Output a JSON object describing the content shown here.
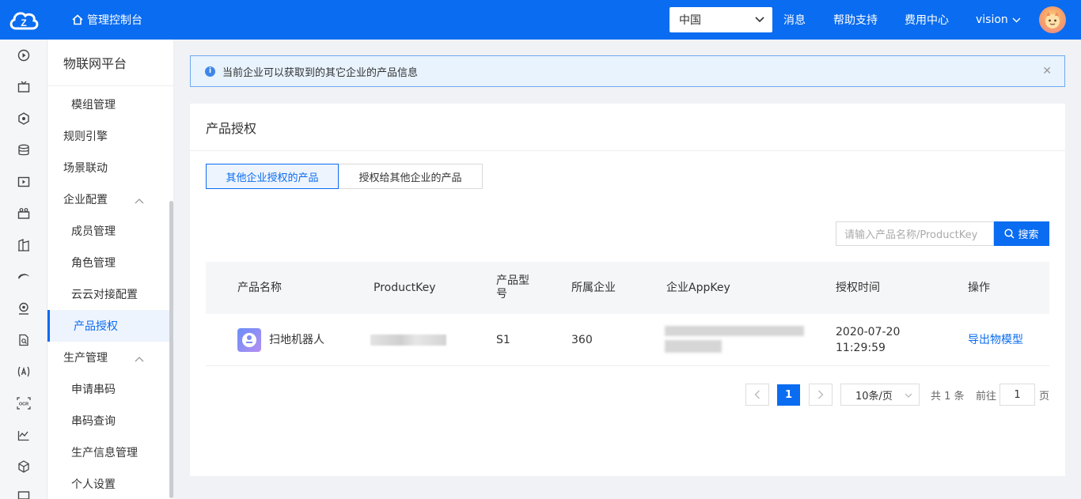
{
  "header": {
    "console_label": "管理控制台",
    "region": "中国",
    "links": [
      "消息",
      "帮助支持",
      "费用中心"
    ],
    "user": "vision"
  },
  "subnav": {
    "title": "物联网平台",
    "items": [
      {
        "label": "模组管理"
      },
      {
        "label": "规则引擎"
      },
      {
        "label": "场景联动"
      },
      {
        "label": "企业配置"
      },
      {
        "label": "成员管理"
      },
      {
        "label": "角色管理"
      },
      {
        "label": "云云对接配置"
      },
      {
        "label": "产品授权"
      },
      {
        "label": "生产管理"
      },
      {
        "label": "申请串码"
      },
      {
        "label": "串码查询"
      },
      {
        "label": "生产信息管理"
      },
      {
        "label": "个人设置"
      }
    ]
  },
  "alert": {
    "text": "当前企业可以获取到的其它企业的产品信息"
  },
  "card": {
    "title": "产品授权",
    "tabs": [
      "其他企业授权的产品",
      "授权给其他企业的产品"
    ],
    "search": {
      "placeholder": "请输入产品名称/ProductKey",
      "button": "搜索"
    },
    "columns": [
      "产品名称",
      "ProductKey",
      "产品型号",
      "所属企业",
      "企业AppKey",
      "授权时间",
      "操作"
    ],
    "rows": [
      {
        "name": "扫地机器人",
        "model": "S1",
        "company": "360",
        "time": "2020-07-20 11:29:59",
        "action": "导出物模型"
      }
    ],
    "pagination": {
      "current": "1",
      "page_size": "10条/页",
      "total": "共 1 条",
      "goto_prefix": "前往",
      "goto_value": "1",
      "goto_suffix": "页"
    }
  },
  "colors": {
    "primary": "#0a6cf0",
    "alert_bg": "#e8f3fe"
  }
}
